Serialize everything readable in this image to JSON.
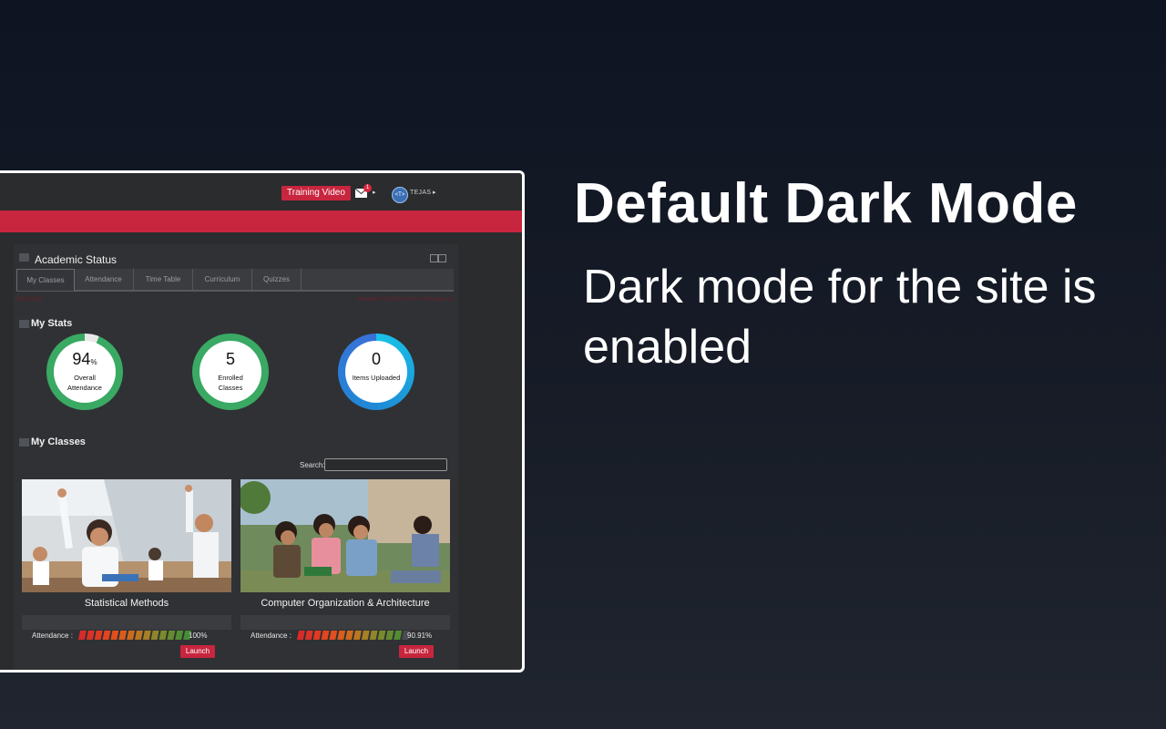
{
  "headline": "Default Dark Mode",
  "subline": "Dark mode for the site is enabled",
  "topbar": {
    "training_video": "Training Video",
    "mail_badge": "1",
    "user_avatar_text": "<T>",
    "user_name": "TEJAS"
  },
  "panel": {
    "title": "Academic Status",
    "tabs": [
      "My Classes",
      "Attendance",
      "Time Table",
      "Curriculum",
      "Quizzes"
    ],
    "sub_left": "2023-2024",
    "sub_right": "Semester III (2023-24) to 3 Semester III"
  },
  "stats": {
    "title": "My Stats",
    "items": [
      {
        "value": "94",
        "unit": "%",
        "label": "Overall Attendance",
        "progress": 0.94,
        "color": "#3aa963"
      },
      {
        "value": "5",
        "unit": "",
        "label": "Enrolled Classes",
        "progress": 1.0,
        "color": "#3aa963"
      },
      {
        "value": "0",
        "unit": "",
        "label": "Items Uploaded",
        "progress": 1.0,
        "color": "#1e8ad6"
      }
    ]
  },
  "classes": {
    "title": "My Classes",
    "search_label": "Search:",
    "items": [
      {
        "name": "Statistical Methods",
        "attendance_label": "Attendance :",
        "attendance": "100%",
        "attendance_fraction": 1.0,
        "launch": "Launch"
      },
      {
        "name": "Computer Organization & Architecture",
        "attendance_label": "Attendance :",
        "attendance": "90.91%",
        "attendance_fraction": 0.9091,
        "launch": "Launch"
      }
    ]
  },
  "colors": {
    "accent": "#c8253e",
    "panel": "#2f3134",
    "background": "#0e1422"
  }
}
